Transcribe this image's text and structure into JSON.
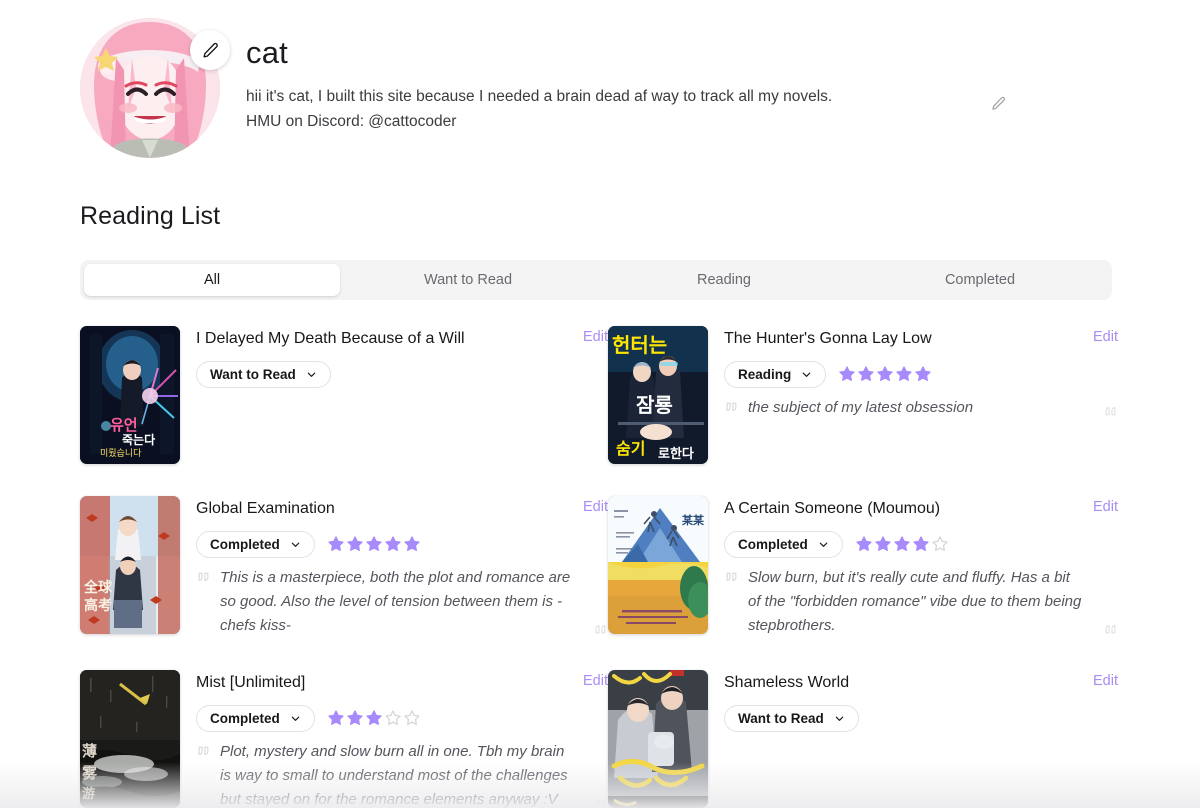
{
  "profile": {
    "username": "cat",
    "bio": "hii it's cat, I built this site because I needed a brain dead af way to track all my novels.\nHMU on Discord: @cattocoder",
    "avatar_edit_icon": "pencil-icon",
    "bio_edit_icon": "pencil-icon"
  },
  "section": {
    "title": "Reading List"
  },
  "tabs": [
    {
      "label": "All",
      "active": true
    },
    {
      "label": "Want to Read",
      "active": false
    },
    {
      "label": "Reading",
      "active": false
    },
    {
      "label": "Completed",
      "active": false
    }
  ],
  "colors": {
    "accent": "#a98df5",
    "star_filled": "#a78bfa",
    "star_empty": "#d4d4d8",
    "tab_bar_bg": "#f4f4f5",
    "text_primary": "#18181b",
    "text_muted": "#6a6a70"
  },
  "edit_label": "Edit",
  "books": [
    {
      "title": "I Delayed My Death Because of a Will",
      "status": "Want to Read",
      "rating": 0,
      "max_rating": 5,
      "review": "",
      "edit_label": "Edit",
      "cover": "cover-dark-blue-figure"
    },
    {
      "title": "The Hunter's Gonna Lay Low",
      "status": "Reading",
      "rating": 5,
      "max_rating": 5,
      "review": "the subject of my latest obsession",
      "edit_label": "Edit",
      "cover": "cover-blue-yellow-duo"
    },
    {
      "title": "Global Examination",
      "status": "Completed",
      "rating": 5,
      "max_rating": 5,
      "review": "This is a masterpiece, both the plot and romance are so good. Also the level of tension between them is -chefs kiss-",
      "edit_label": "Edit",
      "cover": "cover-autumn-red-leaves"
    },
    {
      "title": "A Certain Someone (Moumou)",
      "status": "Completed",
      "rating": 4,
      "max_rating": 5,
      "review": "Slow burn, but it's really cute and fluffy. Has a bit of the \"forbidden romance\" vibe due to them being stepbrothers.",
      "edit_label": "Edit",
      "cover": "cover-mountain-yellow-field"
    },
    {
      "title": "Mist [Unlimited]",
      "status": "Completed",
      "rating": 3,
      "max_rating": 5,
      "review": "Plot, mystery and slow burn all in one. Tbh my brain is way to small to understand most of the challenges but stayed on for the romance elements anyway :V",
      "edit_label": "Edit",
      "cover": "cover-dark-misty-water"
    },
    {
      "title": "Shameless World",
      "status": "Want to Read",
      "rating": 0,
      "max_rating": 5,
      "review": "",
      "edit_label": "Edit",
      "cover": "cover-grey-yellow-pair"
    }
  ]
}
